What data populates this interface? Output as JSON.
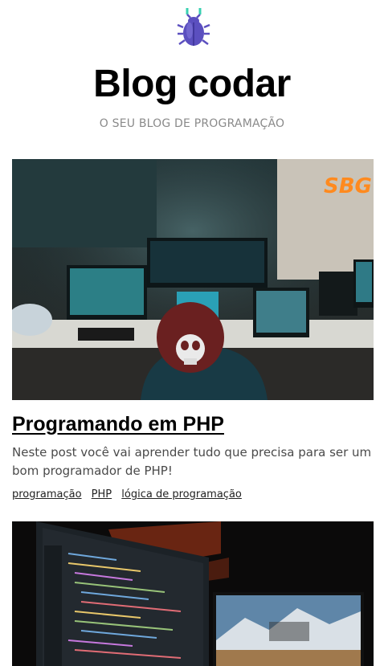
{
  "site": {
    "title": "Blog codar",
    "subtitle": "O SEU BLOG DE PROGRAMAÇÃO",
    "logo_icon": "bug-icon",
    "logo_color": "#5b4fbf",
    "logo_accent": "#3ad1b0"
  },
  "posts": [
    {
      "title": "Programando em PHP",
      "excerpt": "Neste post você vai aprender tudo que precisa para ser um bom programador de PHP!",
      "tags": [
        "programação",
        "PHP",
        "lógica de programação"
      ],
      "image": "photo of a hacker at a desk with multiple monitors"
    },
    {
      "image": "photo of dark monitors showing code"
    }
  ]
}
